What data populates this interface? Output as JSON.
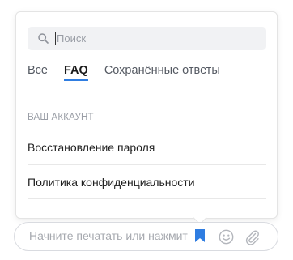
{
  "search": {
    "placeholder": "Поиск"
  },
  "tabs": [
    {
      "label": "Все",
      "active": false
    },
    {
      "label": "FAQ",
      "active": true
    },
    {
      "label": "Сохранённые ответы",
      "active": false
    }
  ],
  "section": {
    "header": "ВАШ АККАУНТ",
    "items": [
      {
        "label": "Восстановление пароля"
      },
      {
        "label": "Политика конфиденциальности"
      }
    ]
  },
  "composer": {
    "placeholder": "Начните печатать или нажмите",
    "icons": [
      "bookmark-icon",
      "smiley-icon",
      "paperclip-icon"
    ]
  },
  "colors": {
    "accent": "#2f7de1",
    "icon_gray": "#b3b6bc"
  }
}
